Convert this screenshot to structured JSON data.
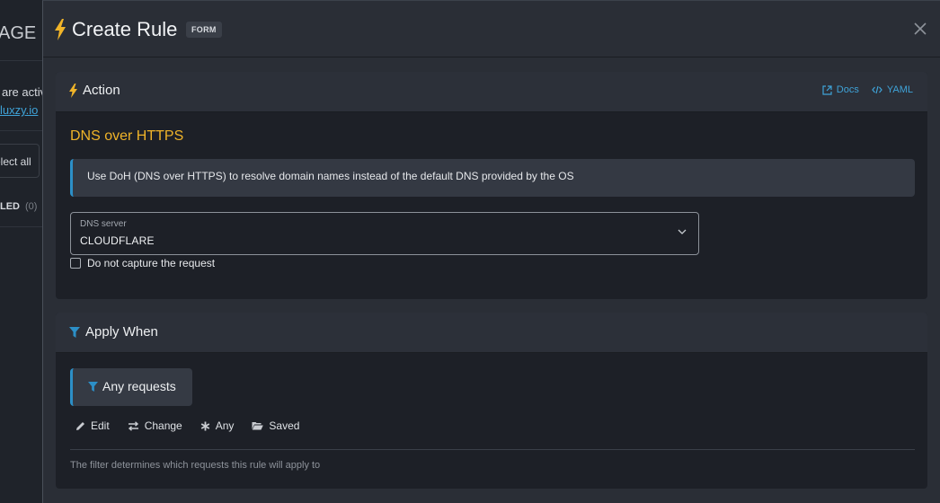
{
  "background": {
    "title": "AGE R",
    "text": "are activ",
    "link": "luxzy.io",
    "select_all": "elect all",
    "tab_label": "LED",
    "tab_count": "(0)"
  },
  "modal": {
    "title": "Create Rule",
    "badge": "FORM",
    "close_icon": "close-icon"
  },
  "action": {
    "header": "Action",
    "links": {
      "docs": "Docs",
      "yaml": "YAML"
    },
    "section_title": "DNS over HTTPS",
    "info": "Use DoH (DNS over HTTPS) to resolve domain names instead of the default DNS provided by the OS",
    "dns_label": "DNS server",
    "dns_value": "CLOUDFLARE",
    "checkbox_label": "Do not capture the request",
    "checkbox_checked": false
  },
  "apply_when": {
    "header": "Apply When",
    "filter": "Any requests",
    "toolbar": {
      "edit": "Edit",
      "change": "Change",
      "any": "Any",
      "saved": "Saved"
    },
    "hint": "The filter determines which requests this rule will apply to"
  },
  "colors": {
    "accent_yellow": "#f0b429",
    "accent_blue": "#2c8fc7",
    "link_blue": "#3fa3d8",
    "background": "#2a2e36"
  }
}
